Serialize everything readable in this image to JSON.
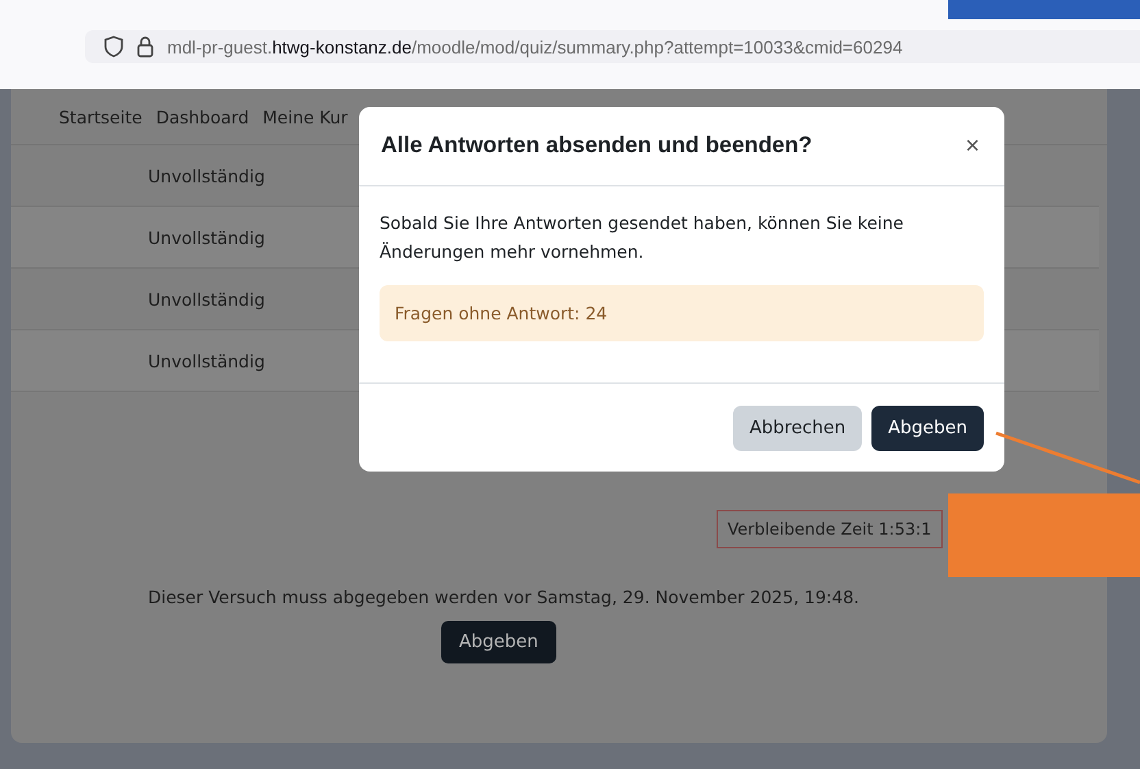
{
  "browser": {
    "url": "mdl-pr-guest.**htwg-konstanz.de**/moodle/mod/quiz/summary.php?attempt=10033&cmid=60294"
  },
  "nav": [
    "Startseite",
    "Dashboard",
    "Meine Kur"
  ],
  "summary_rows": [
    {
      "status": "Unvollständig"
    },
    {
      "status": "Unvollständig"
    },
    {
      "status": "Unvollständig"
    },
    {
      "status": "Unvollständig"
    }
  ],
  "timer": "Verbleibende Zeit 1:53:1",
  "deadline": "Dieser Versuch muss abgegeben werden vor Samstag, 29. November 2025, 19:48.",
  "submit_button": "Abgeben",
  "dialog": {
    "title": "Alle Antworten absenden und beenden?",
    "close": "×",
    "message": "Sobald Sie Ihre Antworten gesendet haben, können Sie keine Änderungen mehr vornehmen.",
    "alert": "Fragen ohne Antwort: 24",
    "buttons": [
      {
        "label": "Abbrechen",
        "kind": "secondary"
      },
      {
        "label": "Abgeben",
        "kind": "primary"
      }
    ]
  }
}
